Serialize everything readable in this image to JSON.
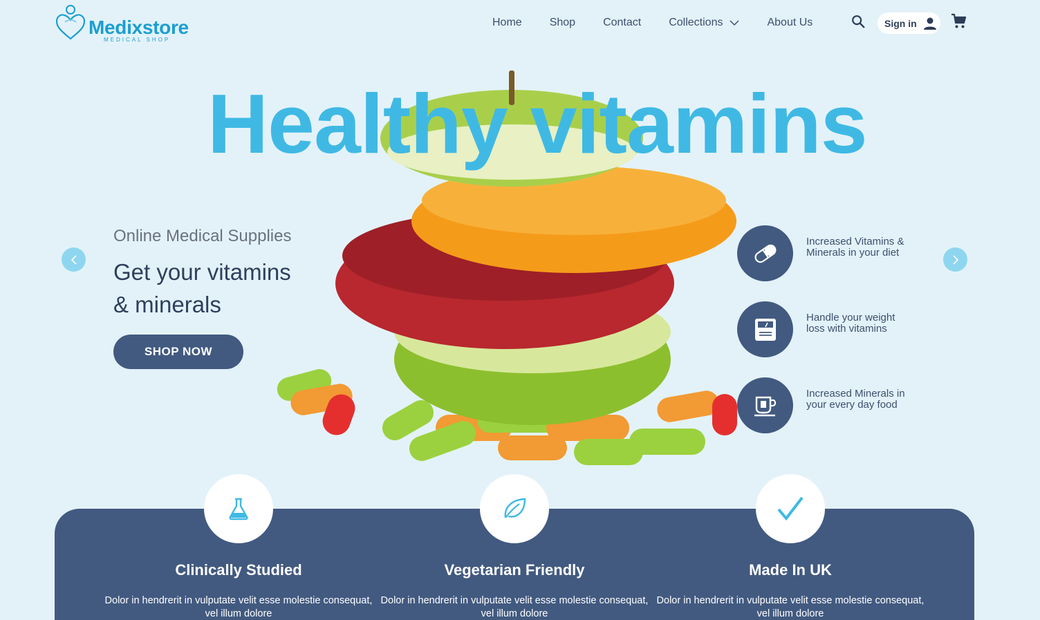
{
  "brand": {
    "name": "Medixstore",
    "tagline": "MEDICAL SHOP",
    "color": "#1a9fd1"
  },
  "nav": {
    "items": [
      {
        "label": "Home"
      },
      {
        "label": "Shop"
      },
      {
        "label": "Contact"
      },
      {
        "label": "Collections",
        "has_dropdown": true
      },
      {
        "label": "About Us"
      }
    ],
    "signin_label": "Sign in"
  },
  "hero": {
    "title": "Healthy vitamins",
    "subtitle": "Online Medical Supplies",
    "headline_line1": "Get your vitamins",
    "headline_line2": "& minerals",
    "cta_label": "SHOP NOW",
    "features": [
      {
        "icon": "capsule-icon",
        "text": "Increased Vitamins & Minerals in your diet"
      },
      {
        "icon": "scale-icon",
        "text": "Handle your weight loss with vitamins"
      },
      {
        "icon": "cup-icon",
        "text": "Increased Minerals in your every day food"
      }
    ]
  },
  "highlights": [
    {
      "icon": "flask-icon",
      "title": "Clinically Studied",
      "text": "Dolor in hendrerit in vulputate velit esse molestie consequat, vel illum dolore"
    },
    {
      "icon": "leaf-icon",
      "title": "Vegetarian Friendly",
      "text": "Dolor in hendrerit in vulputate velit esse molestie consequat, vel illum dolore"
    },
    {
      "icon": "checkmark-icon",
      "title": "Made In UK",
      "text": "Dolor in hendrerit in vulputate velit esse molestie consequat, vel illum dolore"
    }
  ],
  "colors": {
    "background": "#e3f2f9",
    "accent": "#3fb9e4",
    "navy": "#425a80"
  }
}
